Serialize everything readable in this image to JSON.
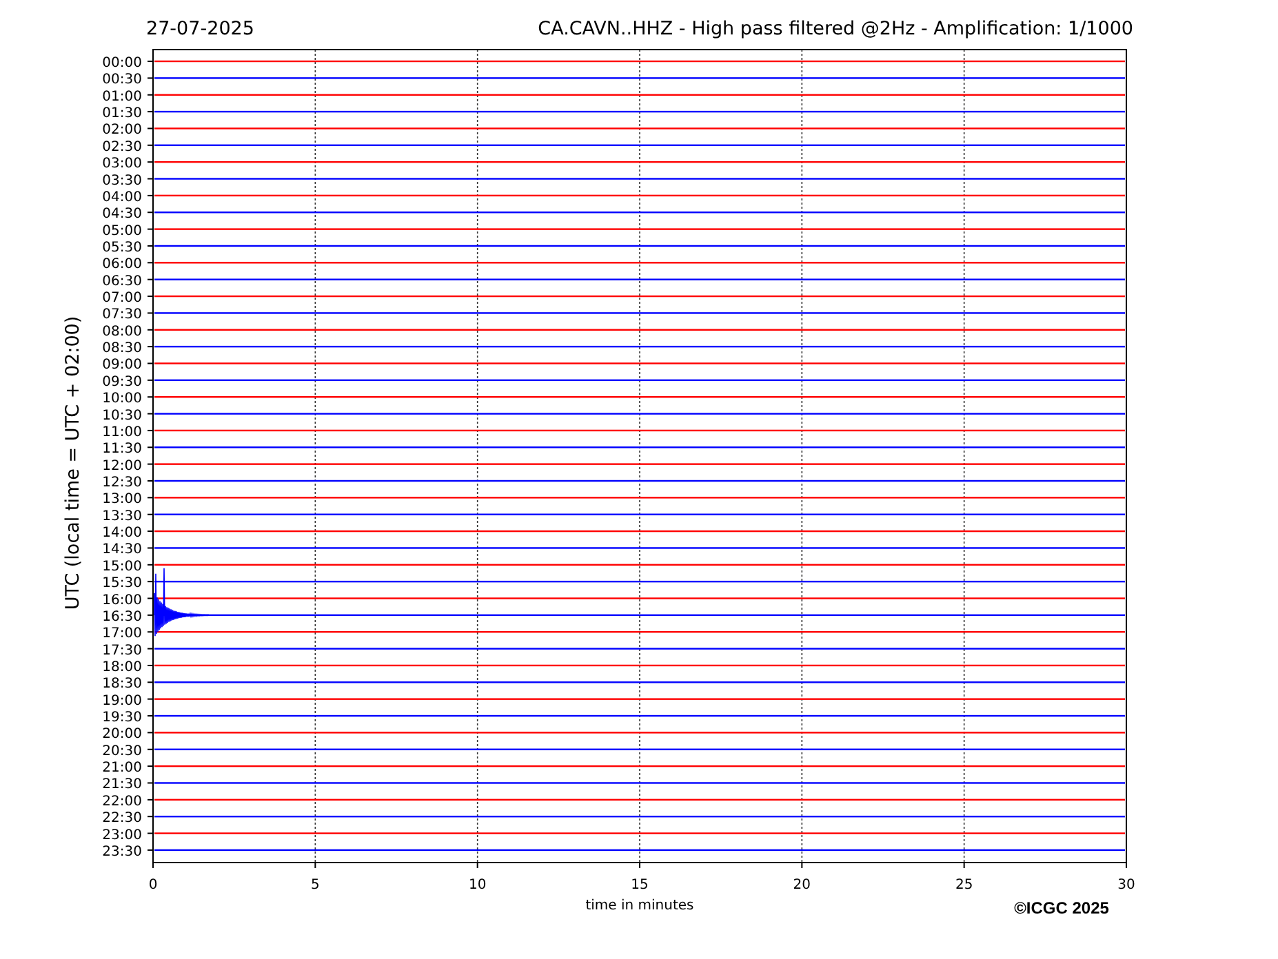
{
  "date": "27-07-2025",
  "title": "CA.CAVN..HHZ - High pass filtered @2Hz - Amplification: 1/1000",
  "ylabel": "UTC (local time = UTC + 02:00)",
  "xlabel": "time in minutes",
  "xticks": [
    "0",
    "5",
    "10",
    "15",
    "20",
    "25",
    "30"
  ],
  "rows": [
    {
      "label": "00:00",
      "color": "#ff0000"
    },
    {
      "label": "00:30",
      "color": "#0000ff"
    },
    {
      "label": "01:00",
      "color": "#ff0000"
    },
    {
      "label": "01:30",
      "color": "#0000ff"
    },
    {
      "label": "02:00",
      "color": "#ff0000"
    },
    {
      "label": "02:30",
      "color": "#0000ff"
    },
    {
      "label": "03:00",
      "color": "#ff0000"
    },
    {
      "label": "03:30",
      "color": "#0000ff"
    },
    {
      "label": "04:00",
      "color": "#ff0000"
    },
    {
      "label": "04:30",
      "color": "#0000ff"
    },
    {
      "label": "05:00",
      "color": "#ff0000"
    },
    {
      "label": "05:30",
      "color": "#0000ff"
    },
    {
      "label": "06:00",
      "color": "#ff0000"
    },
    {
      "label": "06:30",
      "color": "#0000ff"
    },
    {
      "label": "07:00",
      "color": "#ff0000"
    },
    {
      "label": "07:30",
      "color": "#0000ff"
    },
    {
      "label": "08:00",
      "color": "#ff0000"
    },
    {
      "label": "08:30",
      "color": "#0000ff"
    },
    {
      "label": "09:00",
      "color": "#ff0000"
    },
    {
      "label": "09:30",
      "color": "#0000ff"
    },
    {
      "label": "10:00",
      "color": "#ff0000"
    },
    {
      "label": "10:30",
      "color": "#0000ff"
    },
    {
      "label": "11:00",
      "color": "#ff0000"
    },
    {
      "label": "11:30",
      "color": "#0000ff"
    },
    {
      "label": "12:00",
      "color": "#ff0000"
    },
    {
      "label": "12:30",
      "color": "#0000ff"
    },
    {
      "label": "13:00",
      "color": "#ff0000"
    },
    {
      "label": "13:30",
      "color": "#0000ff"
    },
    {
      "label": "14:00",
      "color": "#ff0000"
    },
    {
      "label": "14:30",
      "color": "#0000ff"
    },
    {
      "label": "15:00",
      "color": "#ff0000"
    },
    {
      "label": "15:30",
      "color": "#0000ff"
    },
    {
      "label": "16:00",
      "color": "#ff0000"
    },
    {
      "label": "16:30",
      "color": "#0000ff"
    },
    {
      "label": "17:00",
      "color": "#ff0000"
    },
    {
      "label": "17:30",
      "color": "#0000ff"
    },
    {
      "label": "18:00",
      "color": "#ff0000"
    },
    {
      "label": "18:30",
      "color": "#0000ff"
    },
    {
      "label": "19:00",
      "color": "#ff0000"
    },
    {
      "label": "19:30",
      "color": "#0000ff"
    },
    {
      "label": "20:00",
      "color": "#ff0000"
    },
    {
      "label": "20:30",
      "color": "#0000ff"
    },
    {
      "label": "21:00",
      "color": "#ff0000"
    },
    {
      "label": "21:30",
      "color": "#0000ff"
    },
    {
      "label": "22:00",
      "color": "#ff0000"
    },
    {
      "label": "22:30",
      "color": "#0000ff"
    },
    {
      "label": "23:00",
      "color": "#ff0000"
    },
    {
      "label": "23:30",
      "color": "#0000ff"
    }
  ],
  "copyright": "©ICGC 2025"
}
